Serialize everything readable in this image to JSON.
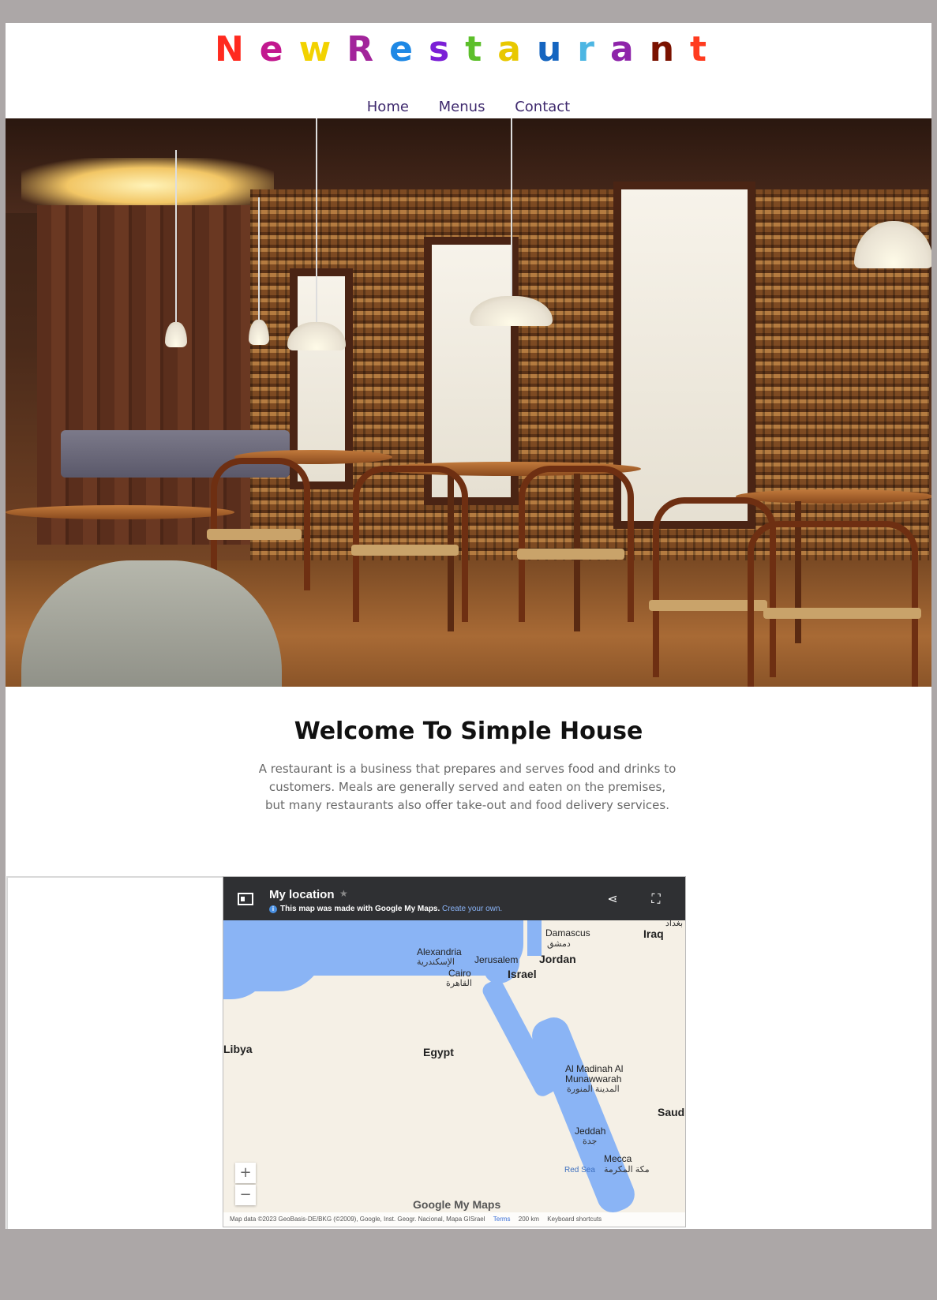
{
  "header": {
    "logo_letters": [
      {
        "ch": "N",
        "color": "#ff2a1f"
      },
      {
        "ch": "e",
        "color": "#c2188f"
      },
      {
        "ch": "w",
        "color": "#f2d200"
      },
      {
        "ch": "R",
        "color": "#a2249b"
      },
      {
        "ch": "e",
        "color": "#1e88e5"
      },
      {
        "ch": "s",
        "color": "#7b1fd6"
      },
      {
        "ch": "t",
        "color": "#5cbf2a"
      },
      {
        "ch": "a",
        "color": "#e8c800"
      },
      {
        "ch": "u",
        "color": "#1565c0"
      },
      {
        "ch": "r",
        "color": "#4db6e3"
      },
      {
        "ch": "a",
        "color": "#8e24aa"
      },
      {
        "ch": "n",
        "color": "#7b1200"
      },
      {
        "ch": "t",
        "color": "#ff3b1f"
      }
    ],
    "nav": {
      "home": "Home",
      "menus": "Menus",
      "contact": "Contact"
    }
  },
  "main": {
    "welcome_title": "Welcome To Simple House",
    "intro": "A restaurant is a business that prepares and serves food and drinks to customers. Meals are generally served and eaten on the premises, but many restaurants also offer take-out and food delivery services."
  },
  "map": {
    "title": "My location",
    "note_text": "This map was made with Google My Maps.",
    "note_link": "Create your own.",
    "labels": {
      "damascus": "Damascus",
      "damascus_ar": "دمشق",
      "iraq": "Iraq",
      "alexandria": "Alexandria",
      "alexandria_ar": "الإسكندرية",
      "jerusalem": "Jerusalem",
      "jordan": "Jordan",
      "cairo": "Cairo",
      "cairo_ar": "القاهرة",
      "israel": "Israel",
      "libya": "Libya",
      "egypt": "Egypt",
      "madinah": "Al Madinah Al",
      "madinah2": "Munawwarah",
      "madinah_ar": "المدينة المنورة",
      "saud": "Saud",
      "jeddah": "Jeddah",
      "jeddah_ar": "جدة",
      "mecca": "Mecca",
      "mecca_ar": "مكة المكرمة",
      "red_sea": "Red Sea",
      "baghdad_ar": "بغداد"
    },
    "zoom_in": "+",
    "zoom_out": "−",
    "logo": "Google My Maps",
    "footer": {
      "data": "Map data ©2023 GeoBasis-DE/BKG (©2009), Google, Inst. Geogr. Nacional, Mapa GISrael",
      "terms": "Terms",
      "scale": "200 km",
      "shortcuts": "Keyboard shortcuts"
    }
  }
}
